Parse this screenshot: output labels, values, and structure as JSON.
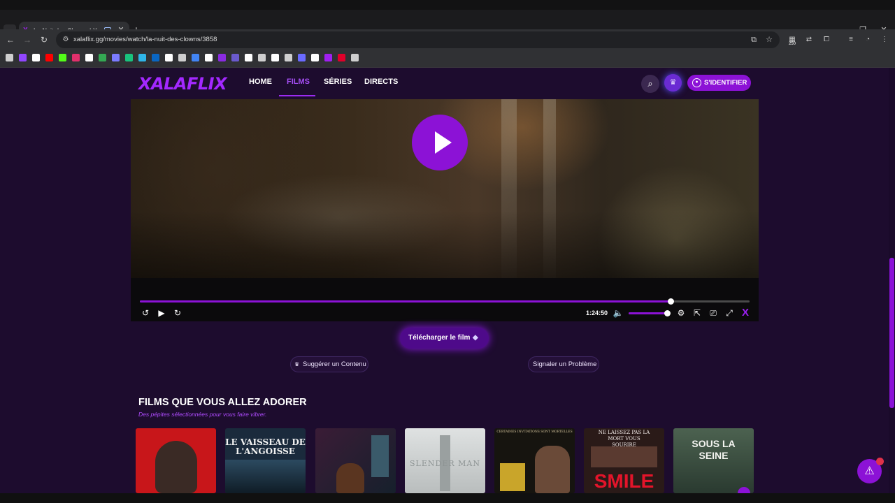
{
  "browser": {
    "tab_title": "La Nuit des Clowns | XalaFlix",
    "tab_favicon": "X",
    "url": "xalaflix.gg/movies/watch/la-nuit-des-clowns/3858",
    "extension_badge": "250",
    "icons": {
      "tab_list": "chevron-down-icon",
      "close": "close-icon",
      "new_tab": "plus-icon",
      "back": "back-arrow-icon",
      "forward": "forward-arrow-icon",
      "reload": "reload-icon",
      "install": "install-app-icon",
      "bookmark": "star-icon",
      "extensions": "puzzle-icon"
    }
  },
  "bookmarks": [
    {
      "name": "apps",
      "color": "#cfcfcf"
    },
    {
      "name": "twitch",
      "color": "#9146ff"
    },
    {
      "name": "x",
      "color": "#ffffff"
    },
    {
      "name": "youtube",
      "color": "#ff0000"
    },
    {
      "name": "kick",
      "color": "#53fc18"
    },
    {
      "name": "instagram",
      "color": "#e1306c"
    },
    {
      "name": "tiktok",
      "color": "#ffffff"
    },
    {
      "name": "sheet",
      "color": "#34a853"
    },
    {
      "name": "ffm",
      "color": "#7b7bff"
    },
    {
      "name": "chat",
      "color": "#19c37d"
    },
    {
      "name": "edge",
      "color": "#2fb5e8"
    },
    {
      "name": "linkedin",
      "color": "#0a66c2"
    },
    {
      "name": "info",
      "color": "#ffffff"
    },
    {
      "name": "openai",
      "color": "#cfcfcf"
    },
    {
      "name": "maps",
      "color": "#4285f4"
    },
    {
      "name": "threads",
      "color": "#ffffff"
    },
    {
      "name": "c-app",
      "color": "#8a2be2"
    },
    {
      "name": "sl",
      "color": "#6a5acd"
    },
    {
      "name": "doc",
      "color": "#ffffff"
    },
    {
      "name": "cmd",
      "color": "#cfcfcf"
    },
    {
      "name": "grid",
      "color": "#ffffff"
    },
    {
      "name": "cloud",
      "color": "#cfcfcf"
    },
    {
      "name": "p-app",
      "color": "#6a6aff"
    },
    {
      "name": "plus",
      "color": "#ffffff"
    },
    {
      "name": "xalaflix",
      "color": "#a020f0"
    },
    {
      "name": "red-app",
      "color": "#e0002a"
    },
    {
      "name": "db",
      "color": "#cfcfcf"
    }
  ],
  "site": {
    "logo": "XALAFLIX",
    "nav": [
      {
        "label": "HOME",
        "active": false
      },
      {
        "label": "FILMS",
        "active": true
      },
      {
        "label": "SÉRIES",
        "active": false
      },
      {
        "label": "DIRECTS",
        "active": false
      }
    ],
    "login_label": "S'IDENTIFIER",
    "accent_color": "#8c12d6"
  },
  "player": {
    "time": "1:24:50",
    "progress": 0.87,
    "volume": 0.93
  },
  "actions": {
    "download_label": "Télécharger le film",
    "suggest_label": "Suggérer un Contenu",
    "report_label": "Signaler un Problème"
  },
  "recommendations": {
    "title": "FILMS QUE VOUS ALLEZ ADORER",
    "subtitle": "Des pépites sélectionnées pour vous faire vibrer.",
    "posters": [
      {
        "text": "",
        "bg": "#c8161a"
      },
      {
        "text": "LE VAISSEAU DE L'ANGOISSE",
        "bg": "#1a2a3c"
      },
      {
        "text": "",
        "bg": "#2c1c2c"
      },
      {
        "text": "SLENDER MAN",
        "bg": "#cfd2d2"
      },
      {
        "text": "CERTAINES INVITATIONS SONT MORTELLES",
        "bg": "#16140f"
      },
      {
        "text": "NE LAISSEZ PAS LA MORT VOUS SOURIRE",
        "bg": "#2a1a18"
      },
      {
        "text": "SOUS LA SEINE",
        "bg": "#3c5040"
      }
    ],
    "extra_text": {
      "smile": "SMILE"
    }
  }
}
